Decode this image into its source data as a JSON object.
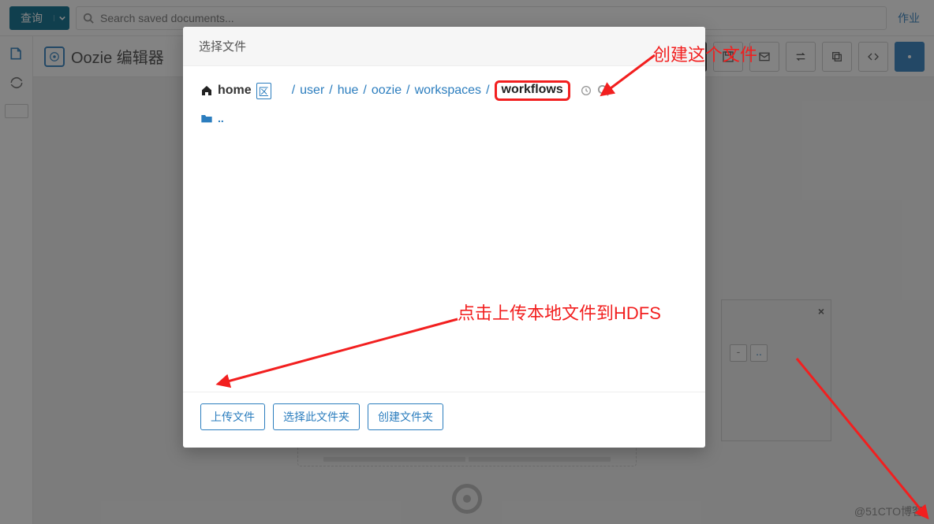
{
  "top": {
    "query_label": "查询",
    "search_placeholder": "Search saved documents...",
    "right_link": "作业"
  },
  "subhead": {
    "title": "Oozie 编辑器"
  },
  "modal": {
    "title": "选择文件",
    "home_label": "home",
    "zone_label": "区",
    "path": [
      "user",
      "hue",
      "oozie",
      "workspaces"
    ],
    "current": "workflows",
    "dotdot": "..",
    "buttons": {
      "upload": "上传文件",
      "select_folder": "选择此文件夹",
      "create_folder": "创建文件夹"
    }
  },
  "annotations": {
    "create_file": "创建这个文件",
    "upload_hint": "点击上传本地文件到HDFS"
  },
  "target_panel": {
    "close": "×",
    "dot1": "-",
    "dot2": ".."
  },
  "watermark": "@51CTO博客"
}
